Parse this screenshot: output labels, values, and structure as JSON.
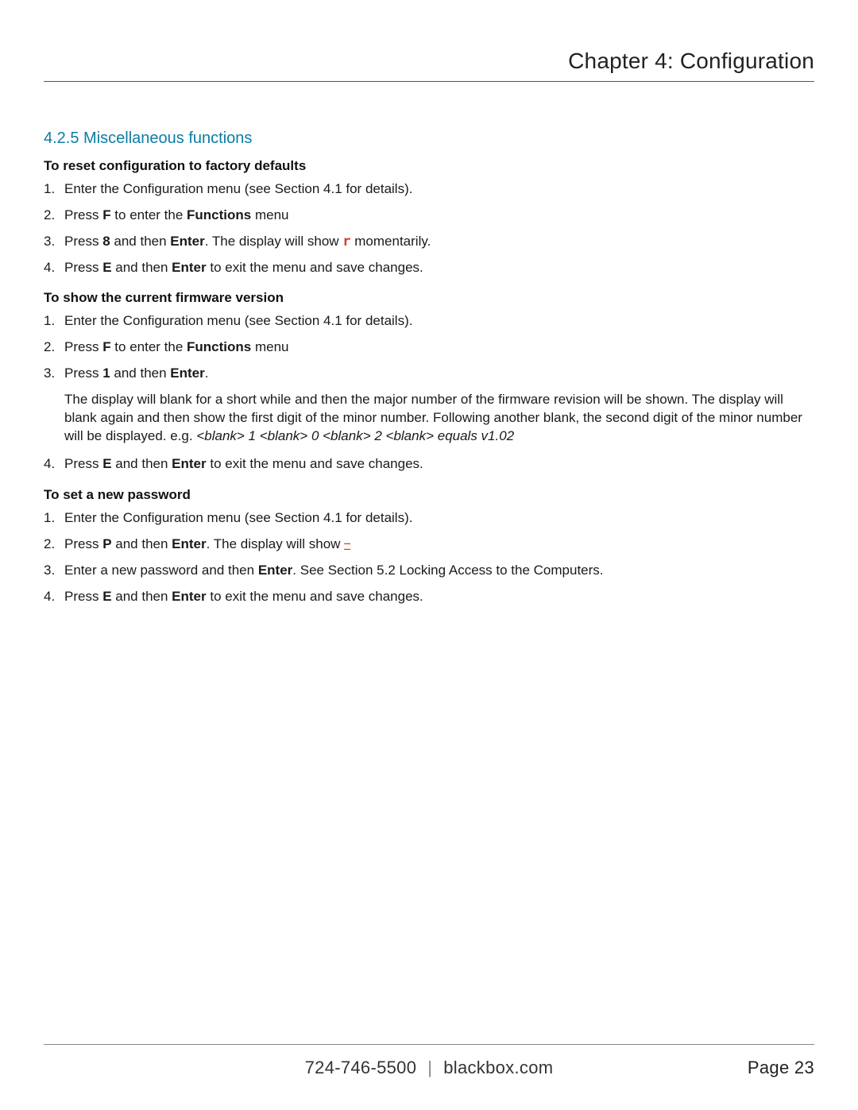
{
  "header": {
    "chapter_title": "Chapter 4: Configuration"
  },
  "section": {
    "number": "4.2.5",
    "title": "Miscellaneous functions"
  },
  "blocks": [
    {
      "heading": "To reset configuration to factory defaults",
      "steps": [
        {
          "html": "Enter the Configuration menu (see Section 4.1 for details)."
        },
        {
          "html": "Press <b>F</b> to enter the <b>Functions</b> menu"
        },
        {
          "html": "Press <b>8</b> and then <b>Enter</b>. The display will show <span class=\"red-seg-r\">r</span> momentarily."
        },
        {
          "html": "Press <b>E</b> and then <b>Enter</b> to exit the menu and save changes."
        }
      ]
    },
    {
      "heading": "To show the current firmware version",
      "steps": [
        {
          "html": "Enter the Configuration menu (see Section 4.1 for details)."
        },
        {
          "html": "Press <b>F</b> to enter the <b>Functions</b> menu"
        },
        {
          "html": "Press <b>1</b> and then <b>Enter</b>.",
          "extra": "The display will blank for a short while and then the major number of the firmware revision will be shown. The display will blank again and then show the first digit of the minor number. Following another blank, the second digit of the minor number will be displayed. e.g. <i>&lt;blank&gt; 1 &lt;blank&gt; 0 &lt;blank&gt; 2 &lt;blank&gt; equals v1.02</i>"
        },
        {
          "html": "Press <b>E</b> and then <b>Enter</b> to exit the menu and save changes."
        }
      ]
    },
    {
      "heading": "To set a new password",
      "steps": [
        {
          "html": "Enter the Configuration menu (see Section 4.1 for details)."
        },
        {
          "html": "Press <b>P</b> and then <b>Enter</b>. The display will show <span class=\"red-seg-glyph\"><span class=\"seg-top\">_</span><span class=\"seg-bot\">_</span></span>"
        },
        {
          "html": "Enter a new password and then <b>Enter</b>. See Section 5.2 Locking Access to the Computers."
        },
        {
          "html": "Press <b>E</b> and then <b>Enter</b> to exit the menu and save changes."
        }
      ]
    }
  ],
  "footer": {
    "phone": "724-746-5500",
    "separator": "|",
    "site": "blackbox.com",
    "page_label": "Page 23"
  }
}
